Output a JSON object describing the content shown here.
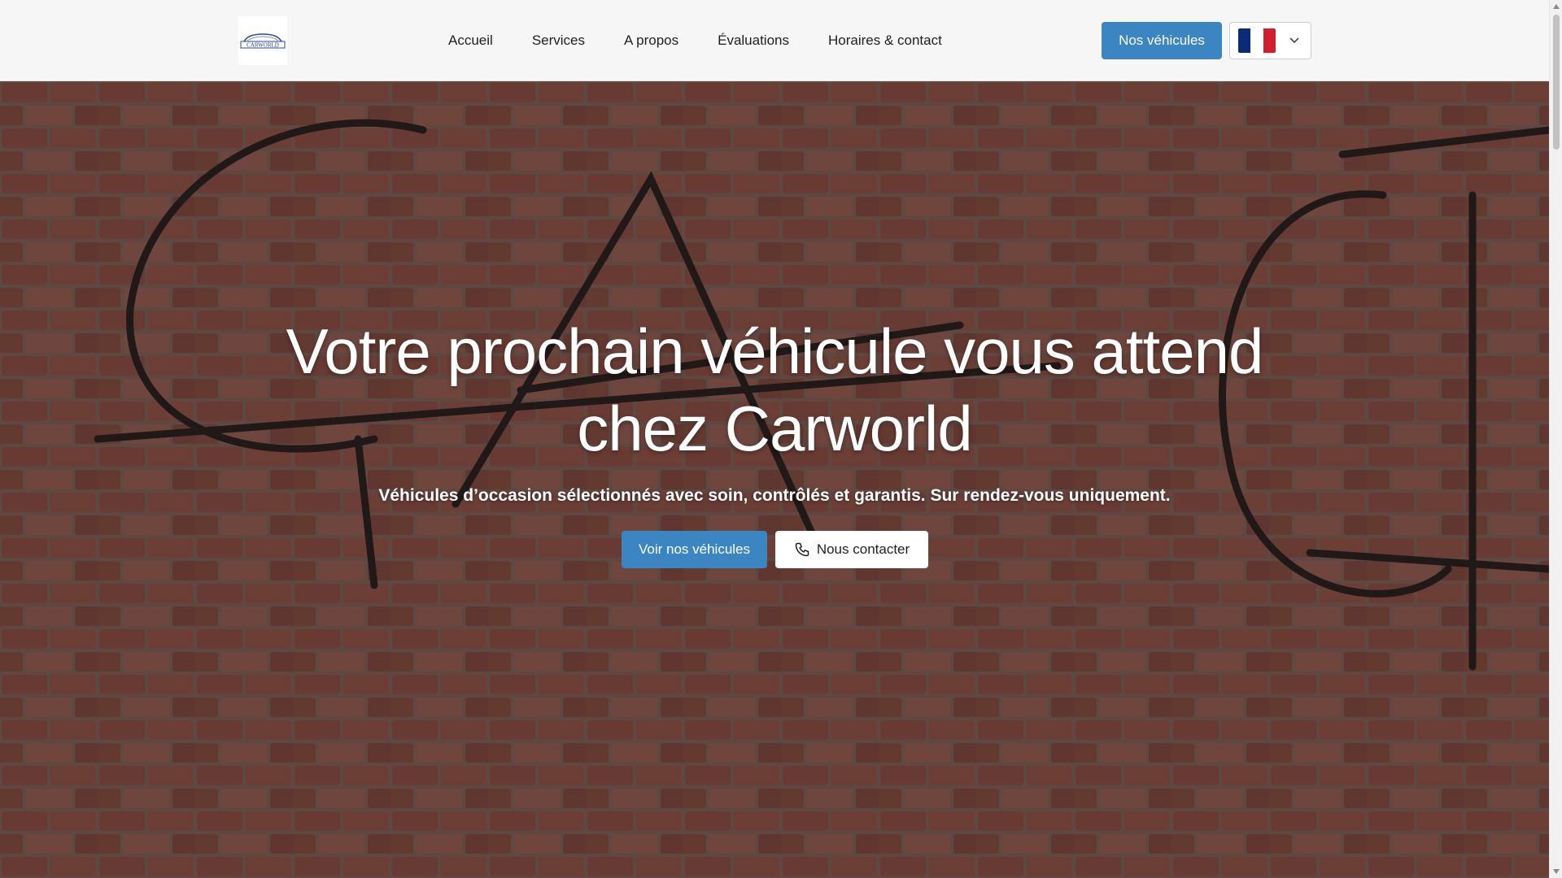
{
  "brand": {
    "logo_text": "CARWORLD"
  },
  "nav": {
    "items": [
      {
        "label": "Accueil"
      },
      {
        "label": "Services"
      },
      {
        "label": "A propos"
      },
      {
        "label": "Évaluations"
      },
      {
        "label": "Horaires & contact"
      }
    ]
  },
  "header": {
    "cta_label": "Nos véhicules",
    "language": {
      "selected": "FR",
      "flag_colors": [
        "#0b2a78",
        "#ffffff",
        "#d21f2f"
      ]
    }
  },
  "hero": {
    "title": "Votre prochain véhicule vous attend chez Carworld",
    "subtitle": "Véhicules d’occasion sélectionnés avec soin, contrôlés et garantis. Sur rendez-vous uniquement.",
    "primary_button": "Voir nos véhicules",
    "secondary_button": "Nous contacter",
    "secondary_icon": "phone-icon"
  },
  "colors": {
    "accent": "#3b86c2",
    "header_bg": "#f6f6f6",
    "text_dark": "#1f1f1f",
    "hero_text": "#ffffff"
  }
}
